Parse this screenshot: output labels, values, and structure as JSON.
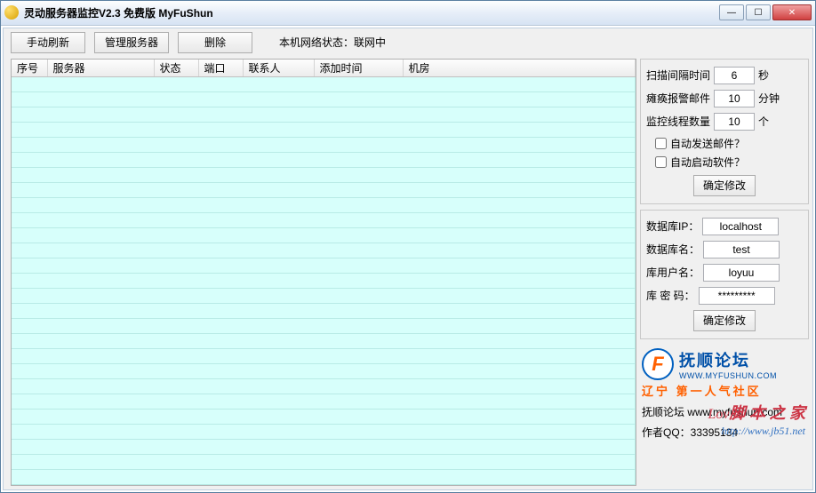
{
  "window": {
    "title": "灵动服务器监控V2.3 免费版 MyFuShun"
  },
  "toolbar": {
    "refresh": "手动刷新",
    "manage": "管理服务器",
    "delete": "删除",
    "netStatus": "本机网络状态：联网中"
  },
  "table": {
    "headers": {
      "seq": "序号",
      "server": "服务器",
      "status": "状态",
      "port": "端口",
      "contact": "联系人",
      "addtime": "添加时间",
      "room": "机房"
    }
  },
  "settings": {
    "scanLabel": "扫描间隔时间",
    "scanValue": "6",
    "scanUnit": "秒",
    "alarmLabel": "瘫痪报警邮件",
    "alarmValue": "10",
    "alarmUnit": "分钟",
    "threadsLabel": "监控线程数量",
    "threadsValue": "10",
    "threadsUnit": "个",
    "autoMail": "自动发送邮件？",
    "autoStart": "自动启动软件？",
    "confirm": "确定修改"
  },
  "db": {
    "ipLabel": "数据库IP：",
    "ipValue": "localhost",
    "nameLabel": "数据库名：",
    "nameValue": "test",
    "userLabel": "库用户名：",
    "userValue": "loyuu",
    "passLabel": "库 密 码：",
    "passValue": "*********",
    "confirm": "确定修改"
  },
  "footer": {
    "logoCn": "抚顺论坛",
    "logoEn": "WWW.MYFUSHUN.COM",
    "logoSub": "辽宁 第一人气社区",
    "site": "抚顺论坛 www.myfushun.com",
    "author": "作者QQ：33395134",
    "wm1a": "Lov",
    "wm1b": "脚 本 之 家",
    "wm2": "http://www.jb51.net"
  }
}
